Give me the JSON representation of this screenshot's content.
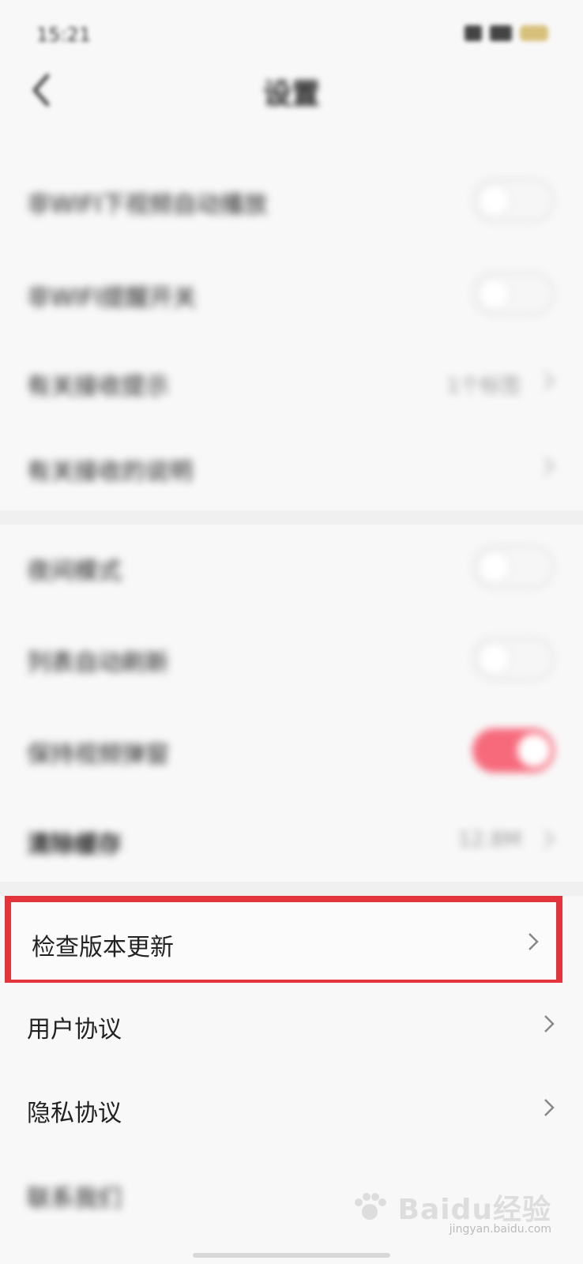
{
  "status_bar": {
    "time": "15:21"
  },
  "header": {
    "title": "设置"
  },
  "rows_top": [
    {
      "label": "非WIFI下视频自动播放",
      "control": "toggle",
      "on": false
    },
    {
      "label": "非WIFI提醒开关",
      "control": "toggle",
      "on": false
    },
    {
      "label": "有关接收提示",
      "control": "value",
      "value": "1个标签"
    },
    {
      "label": "有关接收的说明",
      "control": "chevron"
    }
  ],
  "rows_mid": [
    {
      "label": "夜间模式",
      "control": "toggle",
      "on": false
    },
    {
      "label": "列表自动刷新",
      "control": "toggle",
      "on": false
    },
    {
      "label": "保持视频弹窗",
      "control": "toggle",
      "on": true
    },
    {
      "label": "清除缓存",
      "control": "value",
      "value": "12.8M"
    }
  ],
  "highlight_row": {
    "label": "检查版本更新"
  },
  "rows_bottom": [
    {
      "label": "用户协议"
    },
    {
      "label": "隐私协议"
    },
    {
      "label": "联系我们"
    }
  ],
  "watermark": {
    "brand": "Baidu经验",
    "sub": "jingyan.baidu.com"
  },
  "colors": {
    "toggle_on": "#f66a7c",
    "highlight_border": "#e3333b"
  }
}
